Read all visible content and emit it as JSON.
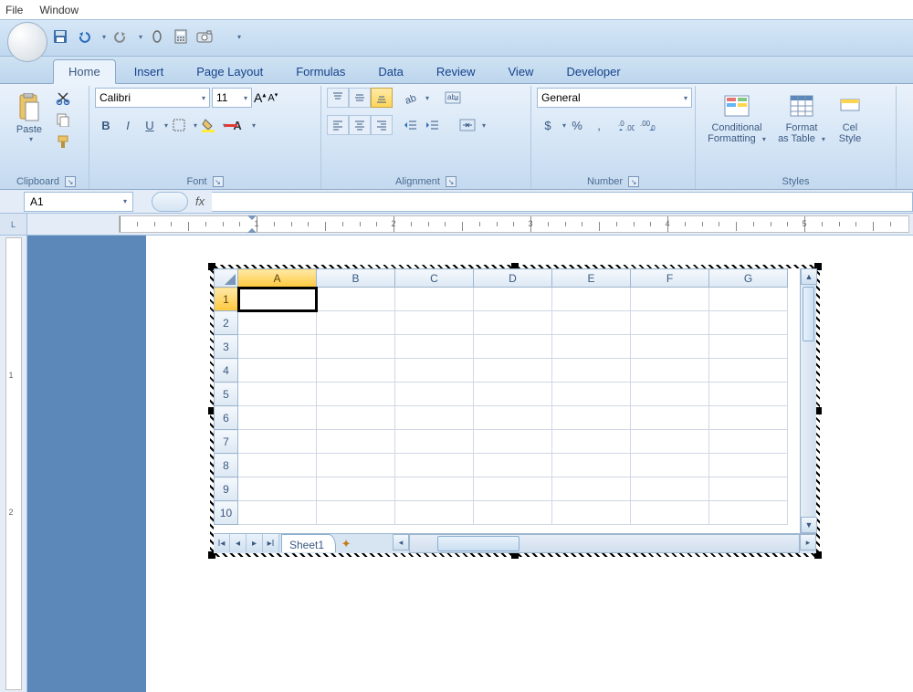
{
  "menubar": {
    "file": "File",
    "window": "Window"
  },
  "tabs": {
    "home": "Home",
    "insert": "Insert",
    "page_layout": "Page Layout",
    "formulas": "Formulas",
    "data": "Data",
    "review": "Review",
    "view": "View",
    "developer": "Developer"
  },
  "ribbon": {
    "clipboard": {
      "label": "Clipboard",
      "paste": "Paste"
    },
    "font": {
      "label": "Font",
      "name": "Calibri",
      "size": "11",
      "bold": "B",
      "italic": "I",
      "underline": "U"
    },
    "alignment": {
      "label": "Alignment"
    },
    "number": {
      "label": "Number",
      "format": "General",
      "currency": "$",
      "percent": "%",
      "comma": ","
    },
    "styles": {
      "label": "Styles",
      "conditional": "Conditional",
      "conditional2": "Formatting",
      "format_table": "Format",
      "format_table2": "as Table",
      "cell": "Cel",
      "cell2": "Style"
    }
  },
  "formula_bar": {
    "name_box": "A1",
    "fx": "fx"
  },
  "sheet": {
    "columns": [
      "A",
      "B",
      "C",
      "D",
      "E",
      "F",
      "G"
    ],
    "rows": [
      "1",
      "2",
      "3",
      "4",
      "5",
      "6",
      "7",
      "8",
      "9",
      "10"
    ],
    "active_col": "A",
    "active_row": "1",
    "tab_name": "Sheet1"
  },
  "ruler": {
    "nums": [
      "1",
      "2",
      "3",
      "4",
      "5"
    ],
    "vnums": [
      "1",
      "2"
    ]
  }
}
